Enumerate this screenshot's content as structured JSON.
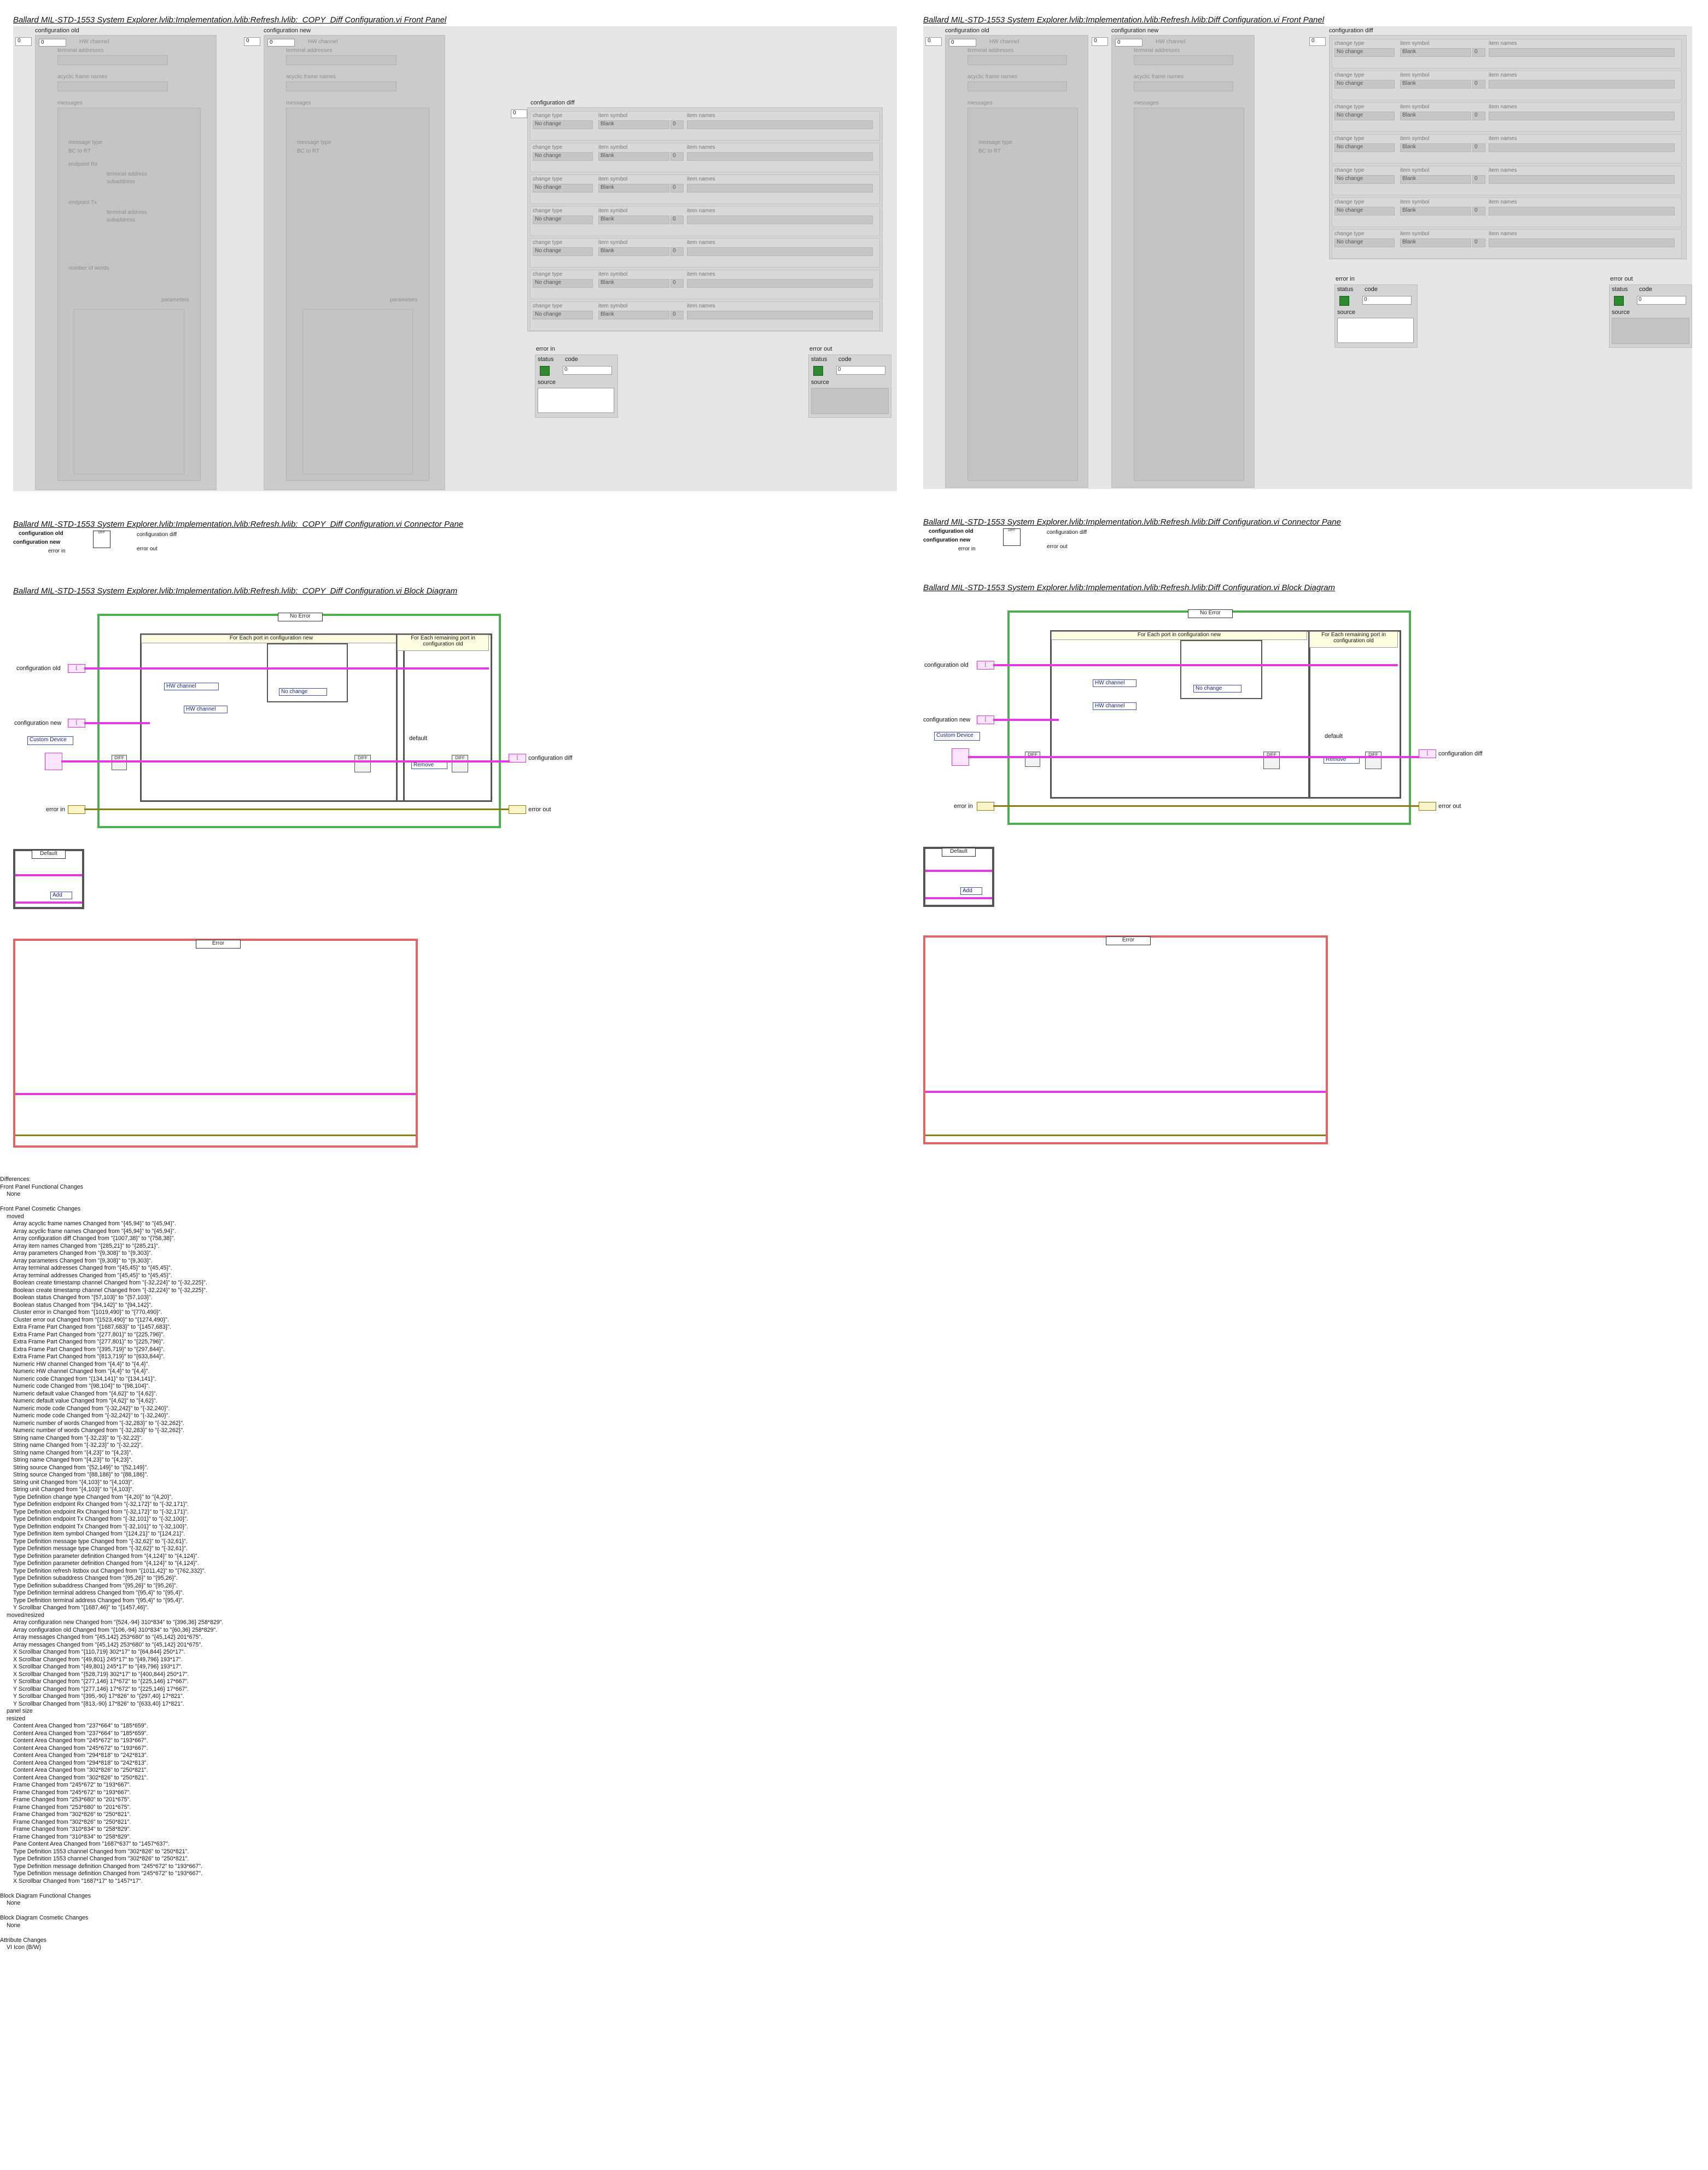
{
  "left_panel": {
    "fp_title": "Ballard MIL-STD-1553 System Explorer.lvlib:Implementation.lvlib:Refresh.lvlib:_COPY_Diff Configuration.vi Front Panel",
    "cp_title": "Ballard MIL-STD-1553 System Explorer.lvlib:Implementation.lvlib:Refresh.lvlib:_COPY_Diff Configuration.vi Connector Pane",
    "bd_title": "Ballard MIL-STD-1553 System Explorer.lvlib:Implementation.lvlib:Refresh.lvlib:_COPY_Diff Configuration.vi Block Diagram"
  },
  "right_panel": {
    "fp_title": "Ballard MIL-STD-1553 System Explorer.lvlib:Implementation.lvlib:Refresh.lvlib:Diff Configuration.vi Front Panel",
    "cp_title": "Ballard MIL-STD-1553 System Explorer.lvlib:Implementation.lvlib:Refresh.lvlib:Diff Configuration.vi Connector Pane",
    "bd_title": "Ballard MIL-STD-1553 System Explorer.lvlib:Implementation.lvlib:Refresh.lvlib:Diff Configuration.vi Block Diagram"
  },
  "controls": {
    "config_old": "configuration old",
    "config_new": "configuration new",
    "config_diff": "configuration diff",
    "hw_channel": "HW channel",
    "terminal_addresses": "terminal addresses",
    "acyclic_frame_names": "acyclic frame names",
    "messages": "messages",
    "message_type": "message type",
    "endpoint_rx": "endpoint Rx",
    "endpoint_tx": "endpoint Tx",
    "terminal_address": "terminal address",
    "subaddress": "subaddress",
    "number_of_words": "number of words",
    "parameters": "parameters",
    "name": "name",
    "change_type": "change type",
    "item_symbol": "item symbol",
    "item_names": "item names",
    "no_change": "No change",
    "blank": "Blank",
    "error_in": "error in",
    "error_out": "error out",
    "status": "status",
    "code": "code",
    "source": "source",
    "zero": "0",
    "bc_rt": "BC to RT"
  },
  "block_diagram": {
    "no_error": "No Error",
    "for_each_port_new": "For Each port in configuration new",
    "for_each_remaining": "For Each remaining port in configuration old",
    "hw_channel": "HW channel",
    "no_change": "No change",
    "custom_device": "Custom Device",
    "default": "default",
    "remove": "Remove",
    "add": "Add",
    "default_case": "Default",
    "error_case": "Error",
    "config_old": "configuration old",
    "config_new": "configuration new",
    "config_diff": "configuration diff",
    "error_in": "error in",
    "error_out": "error out"
  },
  "connector": {
    "config_old": "configuration old",
    "config_new": "configuration new",
    "config_diff": "configuration diff",
    "error_in": "error in",
    "error_out": "error out"
  },
  "differences": [
    {
      "t": "Differences:",
      "i": 0
    },
    {
      "t": "Front Panel Functional Changes",
      "i": 0
    },
    {
      "t": "None",
      "i": 1
    },
    {
      "t": "",
      "i": 0
    },
    {
      "t": "Front Panel Cosmetic Changes",
      "i": 0
    },
    {
      "t": "moved",
      "i": 1
    },
    {
      "t": "Array acyclic frame names Changed from \"{45,94}\" to \"{45,94}\".",
      "i": 2
    },
    {
      "t": "Array acyclic frame names Changed from \"{45,94}\" to \"{45,94}\".",
      "i": 2
    },
    {
      "t": "Array configuration diff Changed from \"{1007,38}\" to \"{758,38}\".",
      "i": 2
    },
    {
      "t": "Array item names Changed from \"{285,21}\" to \"{285,21}\".",
      "i": 2
    },
    {
      "t": "Array parameters Changed from \"{9,308}\" to \"{9,303}\".",
      "i": 2
    },
    {
      "t": "Array parameters Changed from \"{9,308}\" to \"{9,303}\".",
      "i": 2
    },
    {
      "t": "Array terminal addresses Changed from \"{45,45}\" to \"{45,45}\".",
      "i": 2
    },
    {
      "t": "Array terminal addresses Changed from \"{45,45}\" to \"{45,45}\".",
      "i": 2
    },
    {
      "t": "Boolean create timestamp channel Changed from \"{-32,224}\" to \"{-32,225}\".",
      "i": 2
    },
    {
      "t": "Boolean create timestamp channel Changed from \"{-32,224}\" to \"{-32,225}\".",
      "i": 2
    },
    {
      "t": "Boolean status Changed from \"{57,103}\" to \"{57,103}\".",
      "i": 2
    },
    {
      "t": "Boolean status Changed from \"{94,142}\" to \"{94,142}\".",
      "i": 2
    },
    {
      "t": "Cluster error in Changed from \"{1019,490}\" to \"{770,490}\".",
      "i": 2
    },
    {
      "t": "Cluster error out Changed from \"{1523,490}\" to \"{1274,490}\".",
      "i": 2
    },
    {
      "t": "Extra Frame Part  Changed from \"{1687,683}\" to \"{1457,683}\".",
      "i": 2
    },
    {
      "t": "Extra Frame Part  Changed from \"{277,801}\" to \"{225,796}\".",
      "i": 2
    },
    {
      "t": "Extra Frame Part  Changed from \"{277,801}\" to \"{225,796}\".",
      "i": 2
    },
    {
      "t": "Extra Frame Part  Changed from \"{395,719}\" to \"{297,844}\".",
      "i": 2
    },
    {
      "t": "Extra Frame Part  Changed from \"{813,719}\" to \"{633,844}\".",
      "i": 2
    },
    {
      "t": "Numeric HW channel Changed from \"{4,4}\" to \"{4,4}\".",
      "i": 2
    },
    {
      "t": "Numeric HW channel Changed from \"{4,4}\" to \"{4,4}\".",
      "i": 2
    },
    {
      "t": "Numeric code Changed from \"{134,141}\" to \"{134,141}\".",
      "i": 2
    },
    {
      "t": "Numeric code Changed from \"{98,104}\" to \"{98,104}\".",
      "i": 2
    },
    {
      "t": "Numeric default value Changed from \"{4,62}\" to \"{4,62}\".",
      "i": 2
    },
    {
      "t": "Numeric default value Changed from \"{4,62}\" to \"{4,62}\".",
      "i": 2
    },
    {
      "t": "Numeric mode code Changed from \"{-32,242}\" to \"{-32,240}\".",
      "i": 2
    },
    {
      "t": "Numeric mode code Changed from \"{-32,242}\" to \"{-32,240}\".",
      "i": 2
    },
    {
      "t": "Numeric number of words Changed from \"{-32,283}\" to \"{-32,262}\".",
      "i": 2
    },
    {
      "t": "Numeric number of words Changed from \"{-32,283}\" to \"{-32,262}\".",
      "i": 2
    },
    {
      "t": "String name Changed from \"{-32,23}\" to \"{-32,22}\".",
      "i": 2
    },
    {
      "t": "String name Changed from \"{-32,23}\" to \"{-32,22}\".",
      "i": 2
    },
    {
      "t": "String name Changed from \"{4,23}\" to \"{4,23}\".",
      "i": 2
    },
    {
      "t": "String name Changed from \"{4,23}\" to \"{4,23}\".",
      "i": 2
    },
    {
      "t": "String source Changed from \"{52,149}\" to \"{52,149}\".",
      "i": 2
    },
    {
      "t": "String source Changed from \"{88,186}\" to \"{88,186}\".",
      "i": 2
    },
    {
      "t": "String unit Changed from \"{4,103}\" to \"{4,103}\".",
      "i": 2
    },
    {
      "t": "String unit Changed from \"{4,103}\" to \"{4,103}\".",
      "i": 2
    },
    {
      "t": "Type Definition change type Changed from \"{4,20}\" to \"{4,20}\".",
      "i": 2
    },
    {
      "t": "Type Definition endpoint Rx Changed from \"{-32,172}\" to \"{-32,171}\".",
      "i": 2
    },
    {
      "t": "Type Definition endpoint Rx Changed from \"{-32,172}\" to \"{-32,171}\".",
      "i": 2
    },
    {
      "t": "Type Definition endpoint Tx Changed from \"{-32,101}\" to \"{-32,100}\".",
      "i": 2
    },
    {
      "t": "Type Definition endpoint Tx Changed from \"{-32,101}\" to \"{-32,100}\".",
      "i": 2
    },
    {
      "t": "Type Definition item symbol Changed from \"{124,21}\" to \"{124,21}\".",
      "i": 2
    },
    {
      "t": "Type Definition message type Changed from \"{-32,62}\" to \"{-32,61}\".",
      "i": 2
    },
    {
      "t": "Type Definition message type Changed from \"{-32,62}\" to \"{-32,61}\".",
      "i": 2
    },
    {
      "t": "Type Definition parameter definition Changed from \"{4,124}\" to \"{4,124}\".",
      "i": 2
    },
    {
      "t": "Type Definition parameter definition Changed from \"{4,124}\" to \"{4,124}\".",
      "i": 2
    },
    {
      "t": "Type Definition refresh listbox out Changed from \"{1011,42}\" to \"{762,332}\".",
      "i": 2
    },
    {
      "t": "Type Definition subaddress Changed from \"{95,26}\" to \"{95,26}\".",
      "i": 2
    },
    {
      "t": "Type Definition subaddress Changed from \"{95,26}\" to \"{95,26}\".",
      "i": 2
    },
    {
      "t": "Type Definition terminal address Changed from \"{95,4}\" to \"{95,4}\".",
      "i": 2
    },
    {
      "t": "Type Definition terminal address Changed from \"{95,4}\" to \"{95,4}\".",
      "i": 2
    },
    {
      "t": "Y Scrollbar  Changed from \"{1687,46}\" to \"{1457,46}\".",
      "i": 2
    },
    {
      "t": "moved/resized",
      "i": 1
    },
    {
      "t": "Array configuration new Changed from \"{524,-94} 310*834\" to \"{396,36} 258*829\".",
      "i": 2
    },
    {
      "t": "Array configuration old Changed from \"{106,-94} 310*834\" to \"{60,36} 258*829\".",
      "i": 2
    },
    {
      "t": "Array messages Changed from \"{45,142} 253*680\" to \"{45,142} 201*675\".",
      "i": 2
    },
    {
      "t": "Array messages Changed from \"{45,142} 253*680\" to \"{45,142} 201*675\".",
      "i": 2
    },
    {
      "t": "X Scrollbar  Changed from \"{110,719} 302*17\" to \"{64,844} 250*17\".",
      "i": 2
    },
    {
      "t": "X Scrollbar  Changed from \"{49,801} 245*17\" to \"{49,796} 193*17\".",
      "i": 2
    },
    {
      "t": "X Scrollbar  Changed from \"{49,801} 245*17\" to \"{49,796} 193*17\".",
      "i": 2
    },
    {
      "t": "X Scrollbar  Changed from \"{528,719} 302*17\" to \"{400,844} 250*17\".",
      "i": 2
    },
    {
      "t": "Y Scrollbar  Changed from \"{277,146} 17*672\" to \"{225,146} 17*667\".",
      "i": 2
    },
    {
      "t": "Y Scrollbar  Changed from \"{277,146} 17*672\" to \"{225,146} 17*667\".",
      "i": 2
    },
    {
      "t": "Y Scrollbar  Changed from \"{395,-90} 17*826\" to \"{297,40} 17*821\".",
      "i": 2
    },
    {
      "t": "Y Scrollbar  Changed from \"{813,-90} 17*826\" to \"{633,40} 17*821\".",
      "i": 2
    },
    {
      "t": "panel size",
      "i": 1
    },
    {
      "t": "resized",
      "i": 1
    },
    {
      "t": "Content Area  Changed from \"237*664\" to \"185*659\".",
      "i": 2
    },
    {
      "t": "Content Area  Changed from \"237*664\" to \"185*659\".",
      "i": 2
    },
    {
      "t": "Content Area  Changed from \"245*672\" to \"193*667\".",
      "i": 2
    },
    {
      "t": "Content Area  Changed from \"245*672\" to \"193*667\".",
      "i": 2
    },
    {
      "t": "Content Area  Changed from \"294*818\" to \"242*813\".",
      "i": 2
    },
    {
      "t": "Content Area  Changed from \"294*818\" to \"242*813\".",
      "i": 2
    },
    {
      "t": "Content Area  Changed from \"302*826\" to \"250*821\".",
      "i": 2
    },
    {
      "t": "Content Area  Changed from \"302*826\" to \"250*821\".",
      "i": 2
    },
    {
      "t": "Frame  Changed from \"245*672\" to \"193*667\".",
      "i": 2
    },
    {
      "t": "Frame  Changed from \"245*672\" to \"193*667\".",
      "i": 2
    },
    {
      "t": "Frame  Changed from \"253*680\" to \"201*675\".",
      "i": 2
    },
    {
      "t": "Frame  Changed from \"253*680\" to \"201*675\".",
      "i": 2
    },
    {
      "t": "Frame  Changed from \"302*826\" to \"250*821\".",
      "i": 2
    },
    {
      "t": "Frame  Changed from \"302*826\" to \"250*821\".",
      "i": 2
    },
    {
      "t": "Frame  Changed from \"310*834\" to \"258*829\".",
      "i": 2
    },
    {
      "t": "Frame  Changed from \"310*834\" to \"258*829\".",
      "i": 2
    },
    {
      "t": "Pane Content Area  Changed from \"1687*637\" to \"1457*637\".",
      "i": 2
    },
    {
      "t": "Type Definition 1553 channel Changed from \"302*826\" to \"250*821\".",
      "i": 2
    },
    {
      "t": "Type Definition 1553 channel Changed from \"302*826\" to \"250*821\".",
      "i": 2
    },
    {
      "t": "Type Definition message definition Changed from \"245*672\" to \"193*667\".",
      "i": 2
    },
    {
      "t": "Type Definition message definition Changed from \"245*672\" to \"193*667\".",
      "i": 2
    },
    {
      "t": "X Scrollbar  Changed from \"1687*17\" to \"1457*17\".",
      "i": 2
    },
    {
      "t": "",
      "i": 0
    },
    {
      "t": "Block Diagram Functional Changes",
      "i": 0
    },
    {
      "t": "None",
      "i": 1
    },
    {
      "t": "",
      "i": 0
    },
    {
      "t": "Block Diagram Cosmetic Changes",
      "i": 0
    },
    {
      "t": "None",
      "i": 1
    },
    {
      "t": "",
      "i": 0
    },
    {
      "t": "Attribute Changes",
      "i": 0
    },
    {
      "t": "VI Icon (B/W)",
      "i": 1
    }
  ]
}
